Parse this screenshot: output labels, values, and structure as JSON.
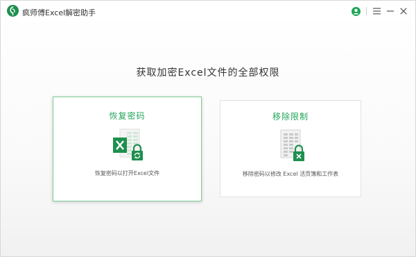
{
  "app": {
    "title": "疯师傅Excel解密助手",
    "logo_icon": "leaf-logo-icon"
  },
  "window_controls": {
    "account_icon": "user-circle-icon",
    "menu_icon": "hamburger-menu-icon",
    "minimize_icon": "minimize-icon",
    "close_icon": "close-icon"
  },
  "main": {
    "headline": "获取加密Excel文件的全部权限"
  },
  "cards": {
    "recover": {
      "title": "恢复密码",
      "description": "恢复密码以打开Excel文件",
      "icon": "excel-lock-refresh-icon"
    },
    "remove": {
      "title": "移除限制",
      "description": "移除密码以修改 Excel 活页簿和工作表",
      "icon": "sheet-lock-remove-icon"
    }
  },
  "colors": {
    "accent_green": "#23a55a",
    "excel_green": "#1f8f4e",
    "card_border_active": "#7ecb97",
    "gray_icon": "#bdbdbd"
  }
}
